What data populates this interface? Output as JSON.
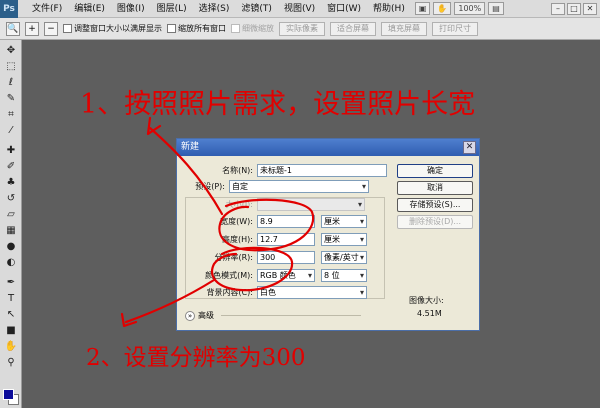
{
  "menubar": {
    "logo": "Ps",
    "items": [
      "文件(F)",
      "编辑(E)",
      "图像(I)",
      "图层(L)",
      "选择(S)",
      "滤镜(T)",
      "视图(V)",
      "窗口(W)",
      "帮助(H)"
    ],
    "zoom": "100%"
  },
  "optbar": {
    "options": [
      {
        "label": "调整窗口大小以满屏显示",
        "enabled": true
      },
      {
        "label": "缩放所有窗口",
        "enabled": true
      },
      {
        "label": "细微缩放",
        "enabled": false
      }
    ],
    "buttons": [
      "实际像素",
      "适合屏幕",
      "填充屏幕",
      "打印尺寸"
    ]
  },
  "dialog": {
    "title": "新建",
    "name_label": "名称(N):",
    "name_value": "未标题-1",
    "preset_label": "预设(P):",
    "preset_value": "自定",
    "size_label": "大小(I):",
    "width_label": "宽度(W):",
    "width_value": "8.9",
    "width_unit": "厘米",
    "height_label": "高度(H):",
    "height_value": "12.7",
    "height_unit": "厘米",
    "resolution_label": "分辨率(R):",
    "resolution_value": "300",
    "resolution_unit": "像素/英寸",
    "colormode_label": "颜色模式(M):",
    "colormode_value": "RGB 颜色",
    "bitdepth_value": "8 位",
    "background_label": "背景内容(C):",
    "background_value": "白色",
    "advanced_label": "高级",
    "ok_label": "确定",
    "cancel_label": "取消",
    "save_preset_label": "存储预设(S)...",
    "delete_preset_label": "删除预设(D)...",
    "image_size_label": "图像大小:",
    "image_size_value": "4.51M"
  },
  "annotations": {
    "step1": "1、按照照片需求，设置照片长宽",
    "step2": "2、设置分辨率为300"
  },
  "colors": {
    "annotation": "#e10000",
    "foreground_swatch": "#0b0b9a",
    "background_swatch": "#ffffff",
    "titlebar": "#3a67bd"
  }
}
